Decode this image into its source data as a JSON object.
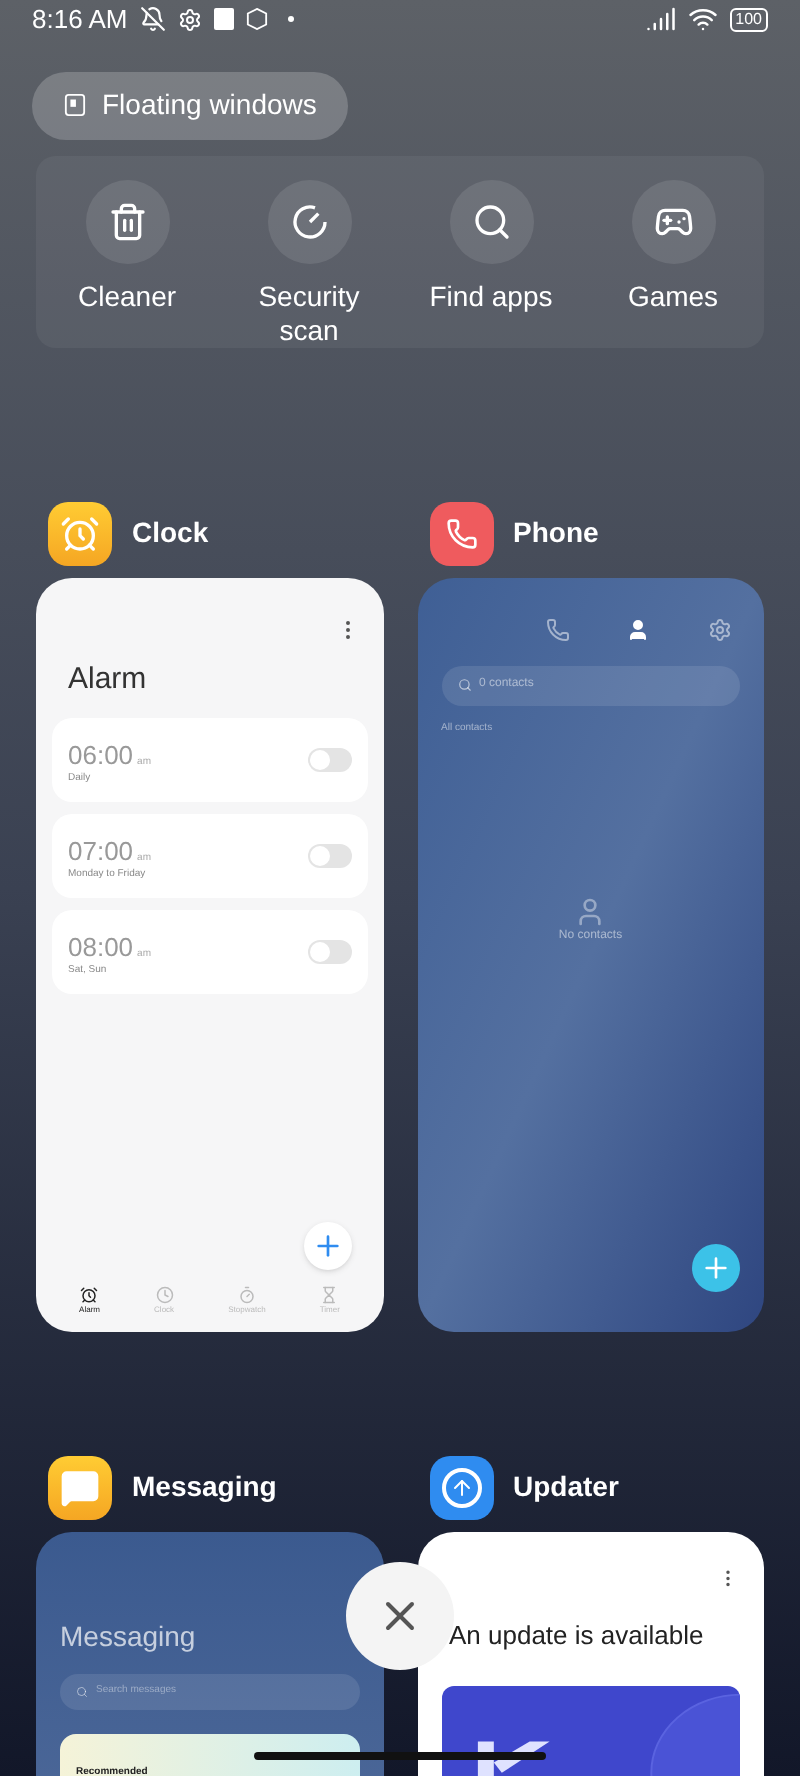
{
  "status_bar": {
    "time": "8:16 AM",
    "battery": "100"
  },
  "floating_windows_button": {
    "label": "Floating windows"
  },
  "quick_actions": [
    {
      "kind": "cleaner",
      "label": "Cleaner"
    },
    {
      "kind": "scan",
      "label": "Security scan"
    },
    {
      "kind": "find",
      "label": "Find apps"
    },
    {
      "kind": "games",
      "label": "Games"
    }
  ],
  "recent_apps": [
    {
      "kind": "clock",
      "name": "Clock",
      "screen": {
        "title": "Alarm",
        "alarms": [
          {
            "time": "06:00",
            "period": "am",
            "repeat": "Daily",
            "on": false
          },
          {
            "time": "07:00",
            "period": "am",
            "repeat": "Monday to Friday",
            "on": false
          },
          {
            "time": "08:00",
            "period": "am",
            "repeat": "Sat, Sun",
            "on": false
          }
        ],
        "tabs": [
          {
            "label": "Alarm",
            "selected": true
          },
          {
            "label": "Clock",
            "selected": false
          },
          {
            "label": "Stopwatch",
            "selected": false
          },
          {
            "label": "Timer",
            "selected": false
          }
        ]
      }
    },
    {
      "kind": "phone",
      "name": "Phone",
      "screen": {
        "tabs": [
          {
            "kind": "calls",
            "selected": false
          },
          {
            "kind": "contacts",
            "selected": true
          },
          {
            "kind": "settings",
            "selected": false
          }
        ],
        "search_placeholder": "0 contacts",
        "filter": "All contacts",
        "empty": "No contacts"
      }
    },
    {
      "kind": "messaging",
      "name": "Messaging",
      "screen": {
        "title": "Messaging",
        "search_placeholder": "Search messages",
        "section": "Recommended"
      }
    },
    {
      "kind": "updater",
      "name": "Updater",
      "screen": {
        "title": "An update is available"
      }
    }
  ]
}
